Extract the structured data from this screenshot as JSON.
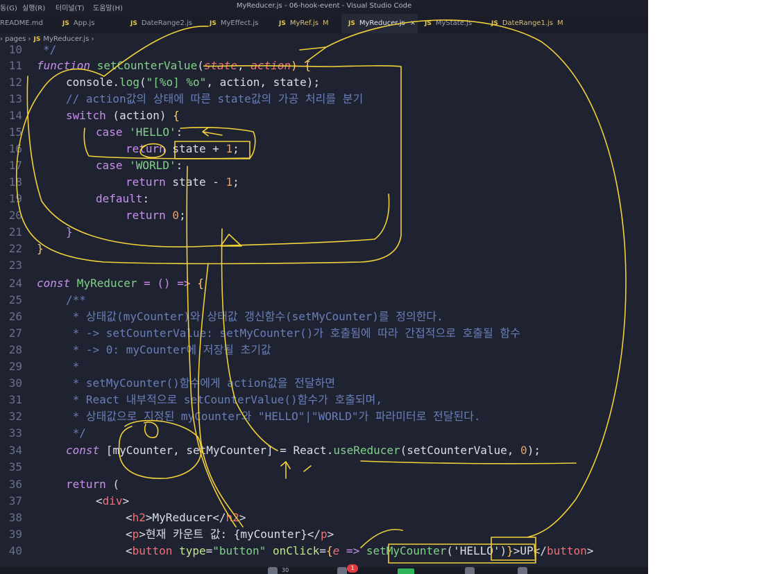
{
  "window": {
    "title": "MyReducer.js - 06-hook-event - Visual Studio Code",
    "menu": [
      "동(G)",
      "실행(R)",
      "터미널(T)",
      "도움말(H)"
    ]
  },
  "tabs": [
    {
      "label": "README.md",
      "js": "",
      "modified": false,
      "active": false
    },
    {
      "label": "App.js",
      "js": "JS",
      "modified": false,
      "active": false
    },
    {
      "label": "DateRange2.js",
      "js": "JS",
      "modified": false,
      "active": false
    },
    {
      "label": "MyEffect.js",
      "js": "JS",
      "modified": false,
      "active": false
    },
    {
      "label": "MyRef.js",
      "js": "JS",
      "modified": true,
      "active": false
    },
    {
      "label": "MyReducer.js",
      "js": "JS",
      "modified": false,
      "active": true
    },
    {
      "label": "MyState.js",
      "js": "JS",
      "modified": false,
      "active": false
    },
    {
      "label": "DateRange1.js",
      "js": "JS",
      "modified": true,
      "active": false
    }
  ],
  "tab_close_glyph": "×",
  "tab_modified_glyph": "M",
  "breadcrumb": {
    "lead": "› pages ›",
    "js": "JS",
    "file": "MyReducer.js ›"
  },
  "code": {
    "line_numbers": [
      "10",
      "11",
      "12",
      "13",
      "14",
      "15",
      "16",
      "17",
      "18",
      "19",
      "20",
      "21",
      "22",
      "23",
      "24",
      "25",
      "26",
      "27",
      "28",
      "29",
      "30",
      "31",
      "32",
      "33",
      "34",
      "35",
      "36",
      "37",
      "38",
      "39",
      "40"
    ],
    "l10": "*/",
    "l11": {
      "kw": "function",
      "name": "setCounterValue",
      "open": "(",
      "p1": "state",
      "comma": ", ",
      "p2": "action",
      "close": ") {"
    },
    "l12": {
      "obj": "console.",
      "fn": "log",
      "open": "(",
      "str": "\"[%o] %o\"",
      "rest": ", action, state);"
    },
    "l13": "// action값의 상태에 따른 state값의 가공 처리를 분기",
    "l14": {
      "kw": "switch",
      "rest": " (action) ",
      "brace": "{"
    },
    "l15": {
      "kw": "case",
      "str": " 'HELLO'",
      "rest": ":"
    },
    "l16": {
      "kw": "return",
      "rest": " state + ",
      "num": "1",
      "end": ";"
    },
    "l17": {
      "kw": "case",
      "str": " 'WORLD'",
      "rest": ":"
    },
    "l18": {
      "kw": "return",
      "rest": " state - ",
      "num": "1",
      "end": ";"
    },
    "l19": {
      "kw": "default",
      "rest": ":"
    },
    "l20": {
      "kw": "return",
      "num": " 0",
      "end": ";"
    },
    "l21": "}",
    "l22": "}",
    "l24": {
      "kw": "const",
      "name": " MyReducer",
      "rest": " = () => ",
      "brace": "{"
    },
    "l25": "/**",
    "l26": " * 상태값(myCounter)와 상태값 갱신함수(setMyCounter)를 정의한다.",
    "l27": " * -> setCounterValue: setMyCounter()가 호출됨에 따라 간접적으로 호출될 함수",
    "l28": " * -> 0: myCounter에 저장될 초기값",
    "l29": " *",
    "l30": " * setMyCounter()함수에게 action값을 전달하면",
    "l31": " * React 내부적으로 setCounterValue()함수가 호출되며,",
    "l32": " * 상태값으로 지정된 myCounter와 \"HELLO\"|\"WORLD\"가 파라미터로 전달된다.",
    "l33": " */",
    "l34": {
      "kw": "const",
      "rest": " [myCounter, setMyCounter] = React.",
      "fn": "useReducer",
      "args": "(setCounterValue, ",
      "num": "0",
      "end": ");"
    },
    "l36": {
      "kw": "return",
      "rest": " ("
    },
    "l37": {
      "open": "<",
      "tag": "div",
      "close": ">"
    },
    "l38": {
      "open": "<",
      "tag": "h2",
      "mid": ">MyReducer</",
      "tag2": "h2",
      "close": ">"
    },
    "l39": {
      "open": "<",
      "tag": "p",
      "mid": ">현재 카운트 값: ",
      "expr": "{myCounter}",
      "end": "</",
      "tag2": "p",
      "close": ">"
    },
    "l40": {
      "open": "<",
      "tag": "button",
      "attr1": " type",
      "eq": "=",
      "val1": "\"button\"",
      "attr2": " onClick",
      "eq2": "=",
      "brace": "{",
      "param": "e",
      "arrow": " => ",
      "fn": "setMyCounter",
      "args": "('HELLO')",
      "brace2": "}",
      "mid": ">UP</",
      "tag2": "button",
      "close": ">"
    }
  },
  "statusbar": {
    "count": "30",
    "badge": "1"
  },
  "colors": {
    "editor_bg": "#1f2230",
    "keyword": "#c792ea",
    "function": "#82d18a",
    "comment": "#6a7fb8",
    "annotation": "#f2d13a"
  }
}
